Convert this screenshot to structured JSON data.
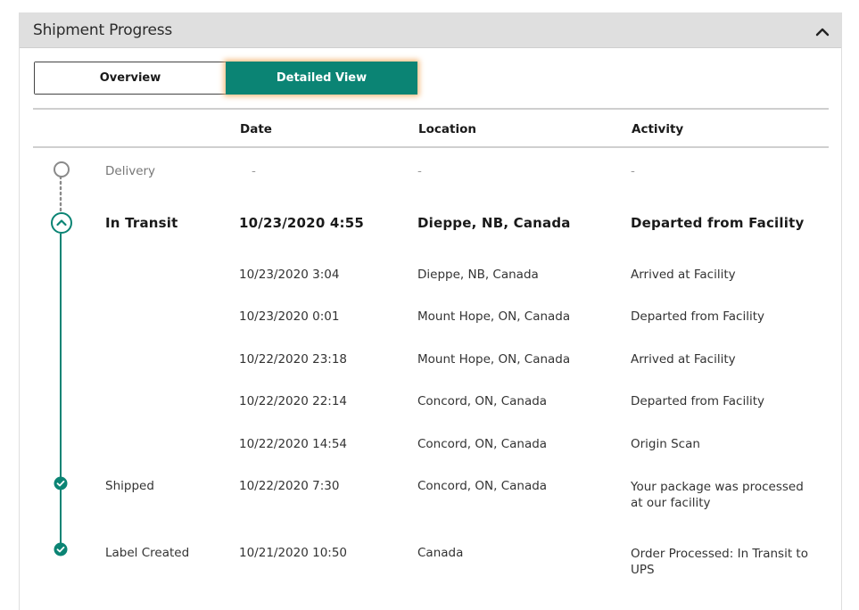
{
  "panel": {
    "title": "Shipment Progress",
    "collapse_icon": "chevron-up-icon"
  },
  "toggle": {
    "overview_label": "Overview",
    "detailed_label": "Detailed View",
    "active": "Detailed View"
  },
  "columns": {
    "date": "Date",
    "location": "Location",
    "activity": "Activity"
  },
  "milestones": [
    {
      "status": "Delivery",
      "date": "-",
      "location": "-",
      "activity": "-"
    },
    {
      "status": "In Transit",
      "date": "10/23/2020  4:55",
      "location": "Dieppe, NB, Canada",
      "activity": "Departed from Facility"
    },
    {
      "status": "Shipped",
      "date": "10/22/2020  7:30",
      "location": "Concord, ON, Canada",
      "activity": "Your package was processed at our facility"
    },
    {
      "status": "Label Created",
      "date": "10/21/2020  10:50",
      "location": "Canada",
      "activity": "Order Processed: In Transit to UPS"
    }
  ],
  "transit_events": [
    {
      "date": "10/23/2020  3:04",
      "location": "Dieppe, NB, Canada",
      "activity": "Arrived at Facility"
    },
    {
      "date": "10/23/2020  0:01",
      "location": "Mount Hope, ON, Canada",
      "activity": "Departed from Facility"
    },
    {
      "date": "10/22/2020  23:18",
      "location": "Mount Hope, ON, Canada",
      "activity": "Arrived at Facility"
    },
    {
      "date": "10/22/2020  22:14",
      "location": "Concord, ON, Canada",
      "activity": "Departed from Facility"
    },
    {
      "date": "10/22/2020  14:54",
      "location": "Concord, ON, Canada",
      "activity": "Origin Scan"
    }
  ],
  "colors": {
    "accent": "#0b8474",
    "header_bg": "#dfdfdf",
    "pending_circle": "#8a8a8a"
  }
}
